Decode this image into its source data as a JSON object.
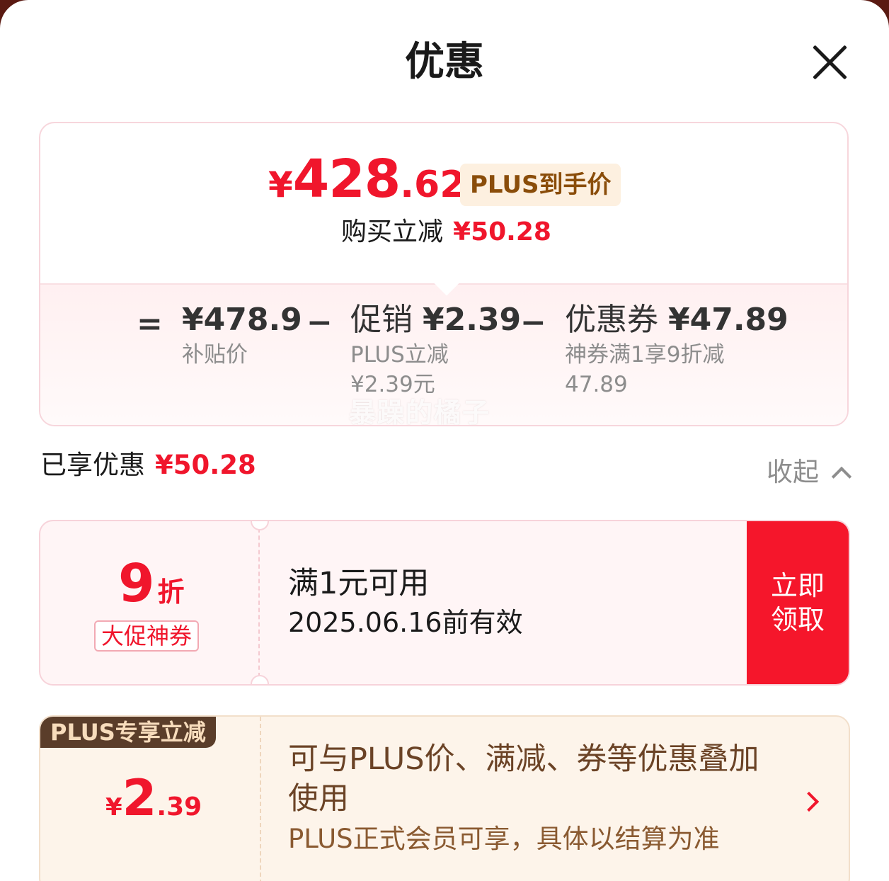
{
  "header": {
    "title": "优惠"
  },
  "summary": {
    "price_symbol": "¥",
    "price_int": "428",
    "price_dec": ".62",
    "price_tag": "PLUS到手价",
    "save_label": "购买立减",
    "save_amount": "¥50.28",
    "equals": "=",
    "minus": "−",
    "subsidy_price": "¥478.9",
    "subsidy_label": "补贴价",
    "promo_label": "促销",
    "promo_amount": "¥2.39",
    "promo_sub1": "PLUS立减",
    "promo_sub2": "¥2.39元",
    "coupon_label": "优惠券",
    "coupon_amount": "¥47.89",
    "coupon_sub1": "神券满1享9折减",
    "coupon_sub2": "47.89",
    "watermark": "暴躁的橘子"
  },
  "enjoyed": {
    "label": "已享优惠",
    "amount": "¥50.28",
    "collapse_label": "收起"
  },
  "coupon": {
    "discount": "9",
    "discount_unit": "折",
    "tag": "大促神券",
    "condition": "满1元可用",
    "valid_until": "2025.06.16前有效",
    "claim_label": "立即领取"
  },
  "plus_card": {
    "badge": "PLUS专享立减",
    "amount_symbol": "¥",
    "amount_int": "2",
    "amount_dec": ".39",
    "description": "可与PLUS价、满减、券等优惠叠加使用",
    "note": "PLUS正式会员可享，具体以结算为准"
  },
  "colors": {
    "accent": "#f0162c",
    "plus_brown": "#5a3d2a",
    "plus_bg": "#fdf4ea"
  },
  "icons": {
    "close": "close-icon",
    "collapse": "chevron-up-icon",
    "more": "chevron-right-icon"
  }
}
